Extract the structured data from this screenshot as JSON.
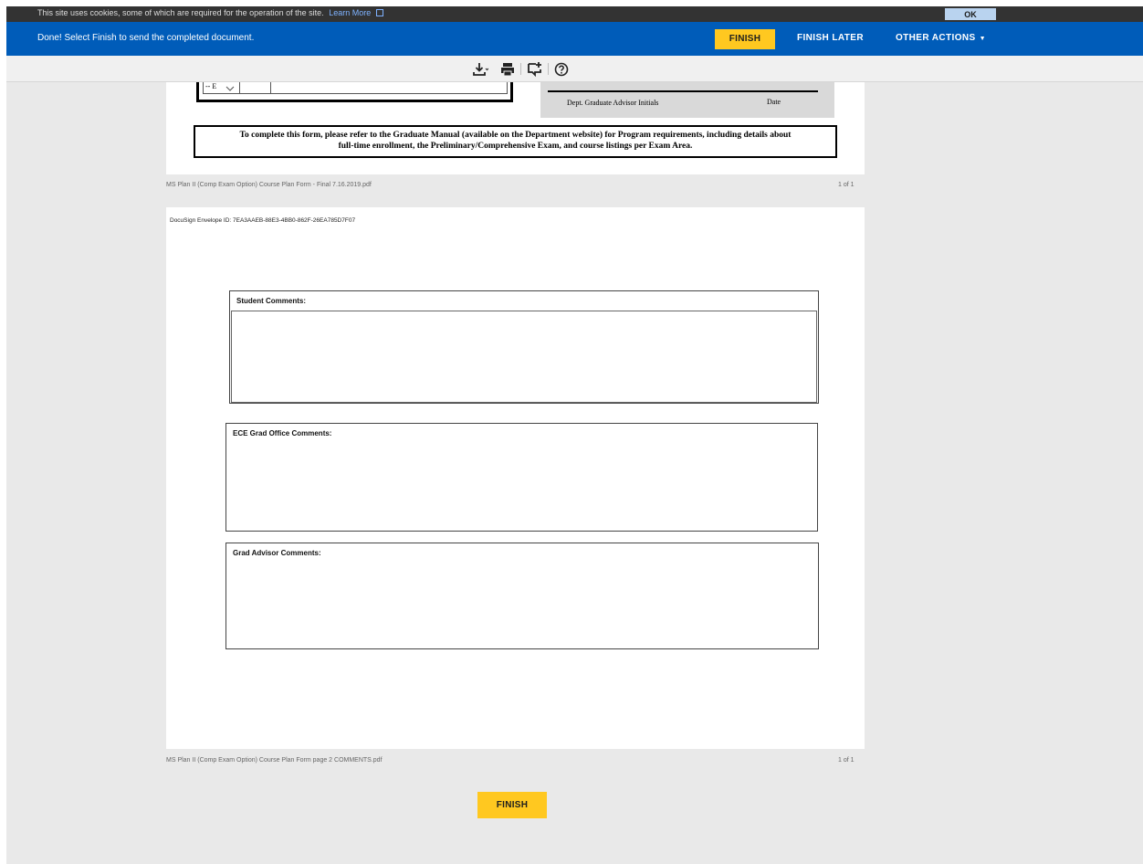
{
  "cookie_bar": {
    "text": "This site uses cookies, some of which are required for the operation of the site.",
    "link": "Learn More",
    "ok_label": "OK"
  },
  "action_bar": {
    "status": "Done! Select Finish to send the completed document.",
    "finish_label": "FINISH",
    "finish_later_label": "FINISH LATER",
    "other_actions_label": "OTHER ACTIONS"
  },
  "toolbar": {
    "icons": [
      "download-icon",
      "print-icon",
      "comment-icon",
      "help-icon"
    ]
  },
  "document1": {
    "select_value": "-- E",
    "advisor_label": "Dept. Graduate Advisor Initials",
    "date_label": "Date",
    "notice_line1": "To complete this form, please refer to the Graduate Manual (available on the Department website) for Program requirements, including details about",
    "notice_line2": "full-time enrollment, the Preliminary/Comprehensive Exam, and course listings per Exam Area.",
    "filename": "MS Plan II (Comp Exam Option) Course Plan Form - Final 7.16.2019.pdf",
    "page_count": "1 of 1"
  },
  "document2": {
    "envelope_id": "DocuSign Envelope ID: 7EA3AAEB-88E3-4BB0-862F-26EA785D7F07",
    "student_comments": "Student Comments:",
    "ece_comments": "ECE Grad Office Comments:",
    "advisor_comments": "Grad Advisor Comments:",
    "filename": "MS Plan II (Comp Exam Option) Course Plan Form page 2 COMMENTS.pdf",
    "page_count": "1 of 1"
  },
  "footer": {
    "finish_label": "FINISH"
  },
  "colors": {
    "action_bar": "#005cb9",
    "finish_button": "#ffc820",
    "cookie_bar": "#333333",
    "background": "#e9e9e9"
  }
}
